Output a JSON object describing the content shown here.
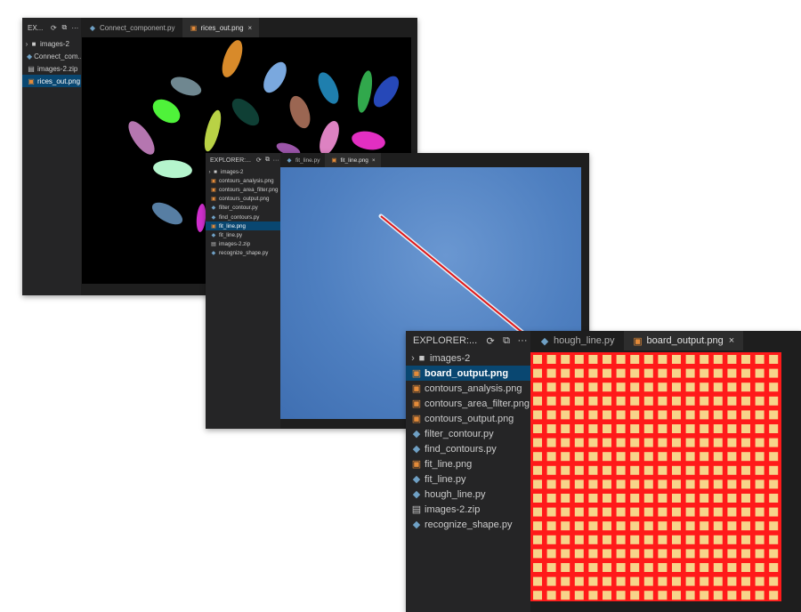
{
  "windows": [
    {
      "explorer_label": "EX...",
      "tabs": [
        {
          "label": "Connect_component.py",
          "icon": "python-file-icon",
          "active": false
        },
        {
          "label": "rices_out.png",
          "icon": "image-file-icon",
          "active": true,
          "close": "×"
        }
      ],
      "tree": [
        {
          "label": "images-2",
          "type": "folder"
        },
        {
          "label": "Connect_com...",
          "type": "py"
        },
        {
          "label": "images-2.zip",
          "type": "zip"
        },
        {
          "label": "rices_out.png",
          "type": "png",
          "selected": true
        }
      ],
      "image": "rice-grains-colored-components"
    },
    {
      "explorer_label": "EXPLORER:...",
      "tabs": [
        {
          "label": "fit_line.py",
          "icon": "python-file-icon",
          "active": false
        },
        {
          "label": "fit_line.png",
          "icon": "image-file-icon",
          "active": true,
          "close": "×"
        }
      ],
      "tree": [
        {
          "label": "images-2",
          "type": "folder"
        },
        {
          "label": "contours_analysis.png",
          "type": "png"
        },
        {
          "label": "contours_area_filter.png",
          "type": "png"
        },
        {
          "label": "contours_output.png",
          "type": "png"
        },
        {
          "label": "filter_contour.py",
          "type": "py"
        },
        {
          "label": "find_contours.py",
          "type": "py"
        },
        {
          "label": "fit_line.png",
          "type": "png",
          "selected": true
        },
        {
          "label": "fit_line.py",
          "type": "py"
        },
        {
          "label": "images-2.zip",
          "type": "zip"
        },
        {
          "label": "recognize_shape.py",
          "type": "py"
        }
      ],
      "image": "sky-contrail-with-red-fitted-line"
    },
    {
      "explorer_label": "EXPLORER:...",
      "tabs": [
        {
          "label": "hough_line.py",
          "icon": "python-file-icon",
          "active": false
        },
        {
          "label": "board_output.png",
          "icon": "image-file-icon",
          "active": true,
          "close": "×"
        }
      ],
      "tree": [
        {
          "label": "images-2",
          "type": "folder"
        },
        {
          "label": "board_output.png",
          "type": "png",
          "selected": true
        },
        {
          "label": "contours_analysis.png",
          "type": "png"
        },
        {
          "label": "contours_area_filter.png",
          "type": "png"
        },
        {
          "label": "contours_output.png",
          "type": "png"
        },
        {
          "label": "filter_contour.py",
          "type": "py"
        },
        {
          "label": "find_contours.py",
          "type": "py"
        },
        {
          "label": "fit_line.png",
          "type": "png"
        },
        {
          "label": "fit_line.py",
          "type": "py"
        },
        {
          "label": "hough_line.py",
          "type": "py"
        },
        {
          "label": "images-2.zip",
          "type": "zip"
        },
        {
          "label": "recognize_shape.py",
          "type": "py"
        }
      ],
      "image": "red-grid-with-yellow-squares"
    }
  ],
  "icons": {
    "refresh": "refresh-icon",
    "collapse": "collapse-all-icon",
    "more": "more-actions-icon",
    "folder": "folder-icon",
    "chevron": "chevron-right-icon",
    "py": "python-file-icon",
    "png": "image-file-icon",
    "zip": "zip-file-icon"
  },
  "colors": {
    "selected_row": "#094771",
    "sidebar_bg": "#252526",
    "editor_bg": "#1e1e1e",
    "board_red": "#ff1a1a",
    "board_square": "#f7d48a",
    "sky_blue": "#4e7fc0",
    "fit_line_red": "#e01818"
  }
}
